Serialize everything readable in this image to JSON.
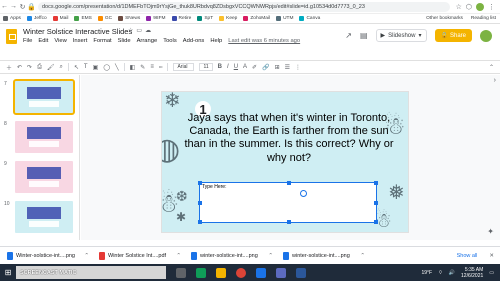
{
  "browser": {
    "url": "docs.google.com/presentation/d/1DMEFbTOjm9rYsjGe_thuk8URbdvq8ZDsbgxVCCQWNWRpjs/edit#slide=id.g10534d0d7773_0_23",
    "right_icons": [
      "star-icon",
      "extension-icon",
      "menu-icon"
    ]
  },
  "bookmarks": {
    "items": [
      {
        "label": "Apps",
        "color": "#5f6368"
      },
      {
        "label": "Jeffco",
        "color": "#1e88e5"
      },
      {
        "label": "Mail",
        "color": "#e53935"
      },
      {
        "label": "EMS",
        "color": "#43a047"
      },
      {
        "label": "GC",
        "color": "#fb8c00"
      },
      {
        "label": "SNews",
        "color": "#6d4c41"
      },
      {
        "label": "98FM",
        "color": "#8e24aa"
      },
      {
        "label": "Retire",
        "color": "#3949ab"
      },
      {
        "label": "SpT",
        "color": "#00897b"
      },
      {
        "label": "Keep",
        "color": "#fbc02d"
      },
      {
        "label": "ZohoMail",
        "color": "#d81b60"
      },
      {
        "label": "UTM",
        "color": "#546e7a"
      },
      {
        "label": "Canva",
        "color": "#00acc1"
      }
    ],
    "other": "Other bookmarks",
    "reading": "Reading list"
  },
  "app": {
    "title": "Winter Solstice Interactive Slides",
    "menus": [
      "File",
      "Edit",
      "View",
      "Insert",
      "Format",
      "Slide",
      "Arrange",
      "Tools",
      "Add-ons",
      "Help"
    ],
    "last_edit": "Last edit was 6 minutes ago",
    "slideshow_label": "Slideshow",
    "share_label": "Share",
    "brand_color": "#f4b400"
  },
  "toolbar": {
    "font": "Arial",
    "font_size": "11"
  },
  "filmstrip": {
    "slides": [
      {
        "num": "7",
        "bg": "#cfeef3",
        "selected": true
      },
      {
        "num": "8",
        "bg": "#f8d7e3",
        "selected": false
      },
      {
        "num": "9",
        "bg": "#f8d7e3",
        "selected": false
      },
      {
        "num": "10",
        "bg": "#cfeef3",
        "selected": false
      }
    ]
  },
  "slide": {
    "number": "1",
    "question": "Jaya says that when it's winter in Toronto, Canada, the Earth is farther from the sun than in the summer. Is this correct? Why or why not?",
    "answer_label": "Type Here:",
    "bg_color": "#cfeef3"
  },
  "downloads": {
    "items": [
      {
        "name": "Winter-solstice-int....png",
        "type": "png"
      },
      {
        "name": "Winter Solstice Int....pdf",
        "type": "pdf"
      },
      {
        "name": "winter-solstice-int....png",
        "type": "png"
      },
      {
        "name": "winter-solstice-int....png",
        "type": "png"
      }
    ],
    "show_all": "Show all"
  },
  "taskbar": {
    "search_text": "Type here to search",
    "watermark": "SCREENCAST MATIC",
    "temperature": "19°F",
    "time": "5:35 AM",
    "date": "12/6/2021"
  }
}
